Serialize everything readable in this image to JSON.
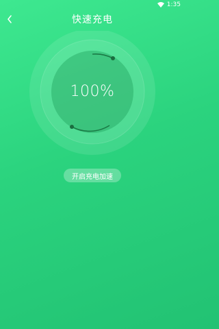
{
  "status_bar": {
    "time": "1:35",
    "wifi_icon": "wifi-icon"
  },
  "header": {
    "title": "快速充电",
    "back_icon": "chevron-left-icon"
  },
  "charge": {
    "percent_text": "100%",
    "level": 1.0
  },
  "actions": {
    "accelerate_label": "开启充电加速"
  },
  "colors": {
    "background_start": "#3ee890",
    "background_end": "#22c273",
    "text": "#ffffff"
  }
}
